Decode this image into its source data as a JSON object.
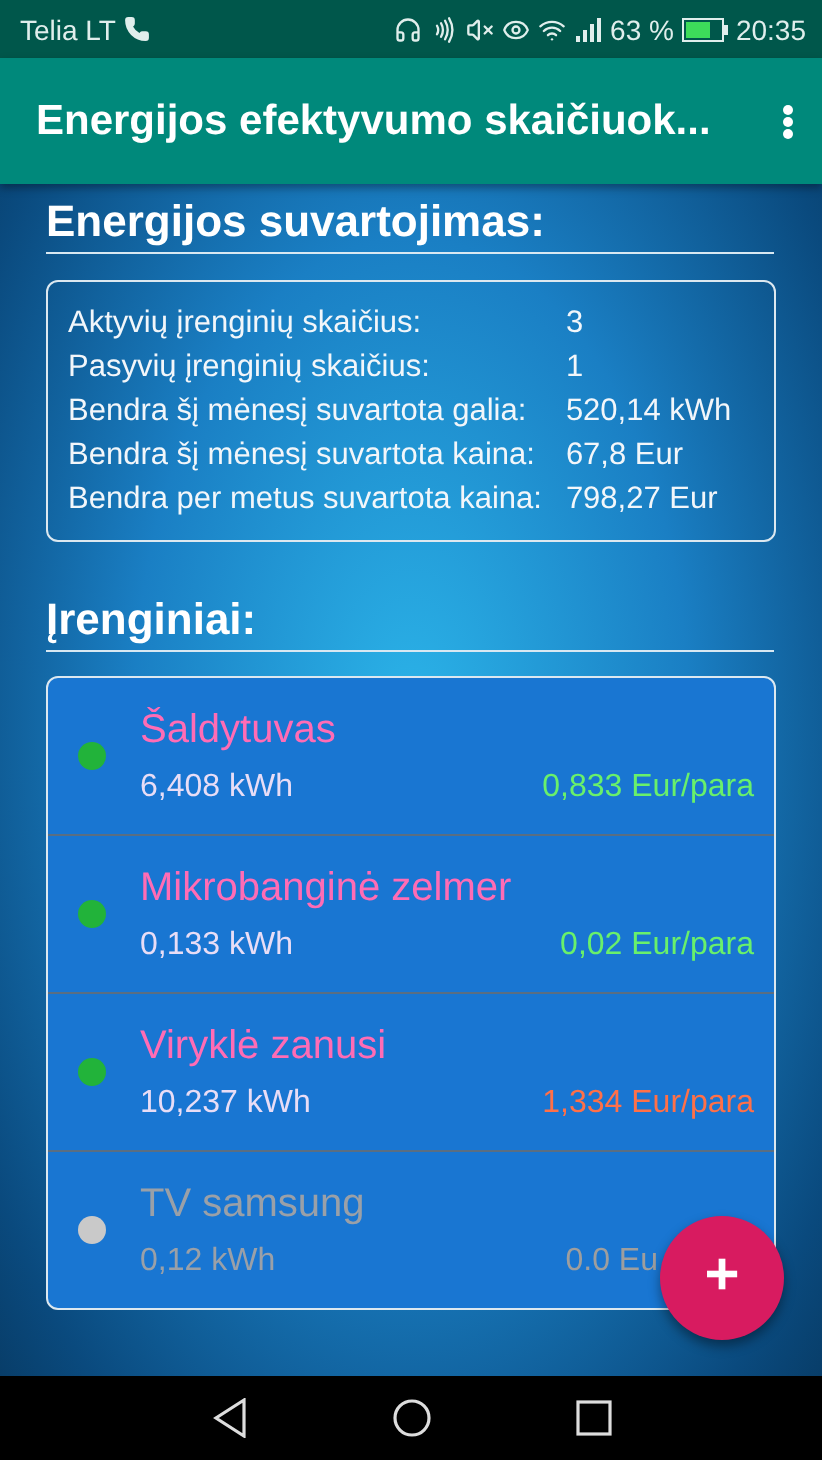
{
  "status_bar": {
    "carrier": "Telia LT",
    "battery": "63 %",
    "time": "20:35"
  },
  "app_bar": {
    "title": "Energijos efektyvumo skaičiuok..."
  },
  "summary": {
    "heading": "Energijos suvartojimas:",
    "rows": [
      {
        "label": "Aktyvių įrenginių skaičius:",
        "value": "3"
      },
      {
        "label": "Pasyvių įrenginių skaičius:",
        "value": "1"
      },
      {
        "label": "Bendra šį mėnesį suvartota galia:",
        "value": "520,14 kWh"
      },
      {
        "label": "Bendra šį mėnesį suvartota kaina:",
        "value": "67,8 Eur"
      },
      {
        "label": "Bendra per metus suvartota kaina:",
        "value": "798,27 Eur"
      }
    ]
  },
  "devices": {
    "heading": "Įrenginiai:",
    "items": [
      {
        "name": "Šaldytuvas",
        "active": true,
        "energy": "6,408 kWh",
        "price": "0,833 Eur/para",
        "color": "#69f06b"
      },
      {
        "name": "Mikrobanginė zelmer",
        "active": true,
        "energy": "0,133 kWh",
        "price": "0,02 Eur/para",
        "color": "#69f06b"
      },
      {
        "name": "Viryklė zanusi",
        "active": true,
        "energy": "10,237 kWh",
        "price": "1,334 Eur/para",
        "color": "#ff7048"
      },
      {
        "name": "TV samsung",
        "active": false,
        "energy": "0,12 kWh",
        "price": "0.0 Eu",
        "color": "#9e9e9e"
      }
    ]
  },
  "fab": {
    "label": "+"
  }
}
